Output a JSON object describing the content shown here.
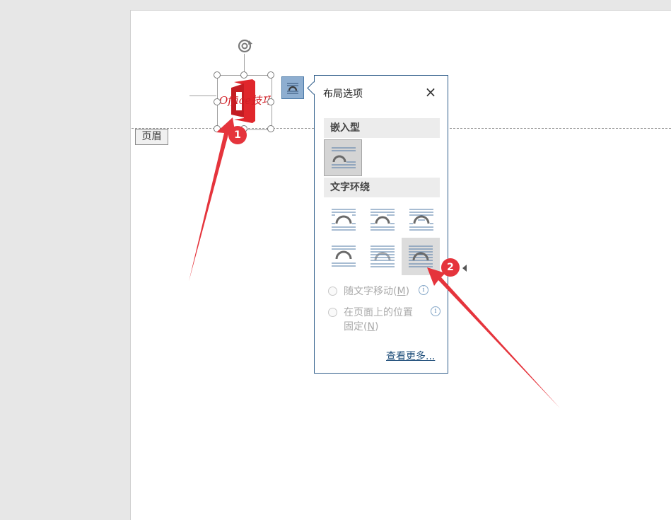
{
  "document": {
    "header_tag": "页眉",
    "logo_text": "Office技巧"
  },
  "layout_panel": {
    "title": "布局选项",
    "close_symbol": "×",
    "inline_section": "嵌入型",
    "wrap_section": "文字环绕",
    "move_with_text": {
      "text": "随文字移动(",
      "key": "M",
      "end": ")"
    },
    "fix_position": {
      "line1": "在页面上的位置",
      "line2_text": "固定(",
      "key": "N",
      "end": ")"
    },
    "info_symbol": "i",
    "see_more": "查看更多...",
    "selected_wrap_option": "in-front-of-text"
  },
  "annotations": {
    "badge_1": "1",
    "badge_2": "2",
    "color": "#e5343c"
  },
  "colors": {
    "accent": "#2f5d8a",
    "logo_red": "#e0262b"
  }
}
